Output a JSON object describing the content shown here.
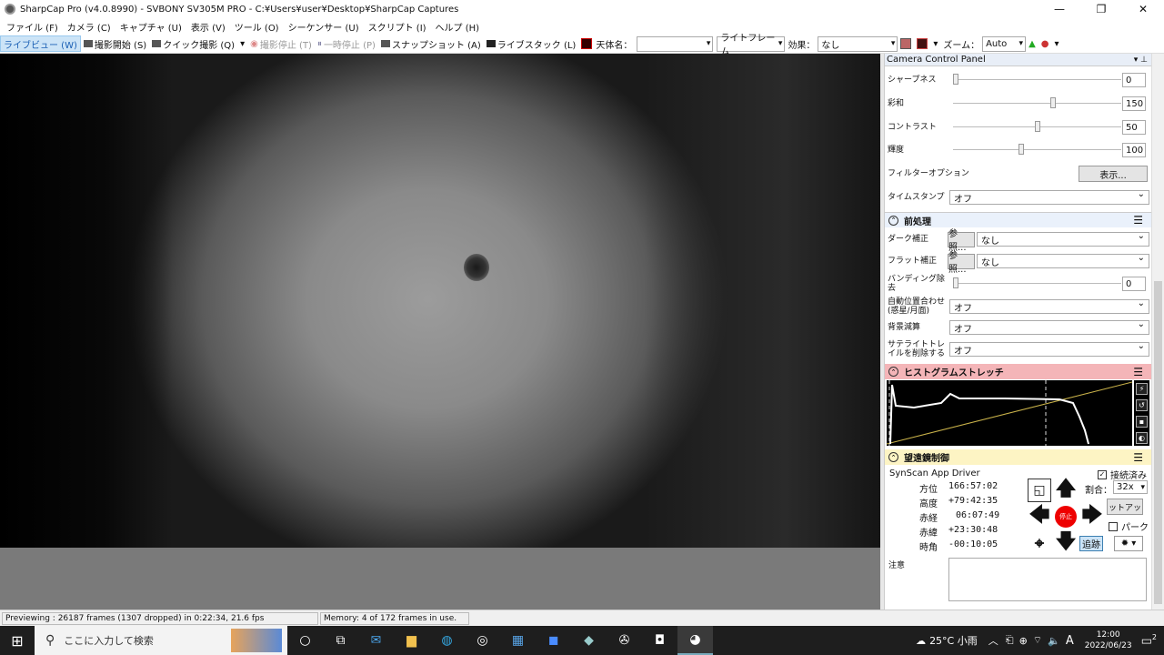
{
  "window": {
    "title": "SharpCap Pro (v4.0.8990) - SVBONY SV305M PRO - C:¥Users¥user¥Desktop¥SharpCap Captures",
    "minimize": "—",
    "maximize": "❐",
    "close": "✕"
  },
  "menu": [
    "ファイル (F)",
    "カメラ (C)",
    "キャプチャ (U)",
    "表示 (V)",
    "ツール (O)",
    "シーケンサー (U)",
    "スクリプト (I)",
    "ヘルプ (H)"
  ],
  "toolbar": {
    "live_view": "ライブビュー (W)",
    "start_capture": "撮影開始 (S)",
    "quick_capture": "クイック撮影 (Q)",
    "stop_capture": "撮影停止 (T)",
    "pause": "一時停止 (P)",
    "snapshot": "スナップショット (A)",
    "live_stack": "ライブスタック (L)",
    "target_label": "天体名：",
    "target_value": "",
    "frame_type": "ライトフレーム",
    "effect_label": "効果：",
    "effect_value": "なし",
    "zoom_label": "ズーム：",
    "zoom_value": "Auto"
  },
  "panel": {
    "title": "Camera Control Panel",
    "sharpness": {
      "label": "シャープネス",
      "value": "0",
      "pos": 0.0
    },
    "saturation": {
      "label": "彩和",
      "value": "150",
      "pos": 0.6
    },
    "contrast": {
      "label": "コントラスト",
      "value": "50",
      "pos": 0.5
    },
    "brightness": {
      "label": "輝度",
      "value": "100",
      "pos": 0.4
    },
    "filter_options": {
      "label": "フィルターオプション",
      "button": "表示..."
    },
    "timestamp": {
      "label": "タイムスタンプ",
      "value": "オフ"
    },
    "preprocess": {
      "title": "前処理",
      "dark": {
        "label": "ダーク補正",
        "browse": "参照...",
        "value": "なし"
      },
      "flat": {
        "label": "フラット補正",
        "browse": "参照...",
        "value": "なし"
      },
      "banding": {
        "label": "バンディング除去",
        "value": "0",
        "pos": 0.0
      },
      "auto_align": {
        "label": "自動位置合わせ (惑星/月面)",
        "value": "オフ"
      },
      "bg_subtract": {
        "label": "背景減算",
        "value": "オフ"
      },
      "sat_trail": {
        "label": "サテライトトレイルを削除する",
        "value": "オフ"
      }
    },
    "histogram": {
      "title": "ヒストグラムストレッチ"
    },
    "telescope": {
      "title": "望遠鏡制御",
      "driver": "SynScan App Driver",
      "connected": "接続済み",
      "azimuth": {
        "label": "方位",
        "value": "166:57:02"
      },
      "altitude": {
        "label": "高度",
        "value": "+79:42:35"
      },
      "ra": {
        "label": "赤経",
        "value": "06:07:49"
      },
      "dec": {
        "label": "赤緯",
        "value": "+23:30:48"
      },
      "hour_angle": {
        "label": "時角",
        "value": "-00:10:05"
      },
      "rate_label": "割合：",
      "rate_value": "32x",
      "stop": "停止",
      "setup": "セットアップ",
      "park": "パーク",
      "tracking": "追跡",
      "notes_label": "注意"
    }
  },
  "status": {
    "preview": "Previewing : 26187 frames (1307 dropped) in 0:22:34, 21.6 fps",
    "memory": "Memory: 4 of 172 frames in use."
  },
  "taskbar": {
    "search_placeholder": "ここに入力して検索",
    "weather": "25°C 小雨",
    "ime": "A",
    "time": "12:00",
    "date": "2022/06/23",
    "notification_count": "2"
  }
}
